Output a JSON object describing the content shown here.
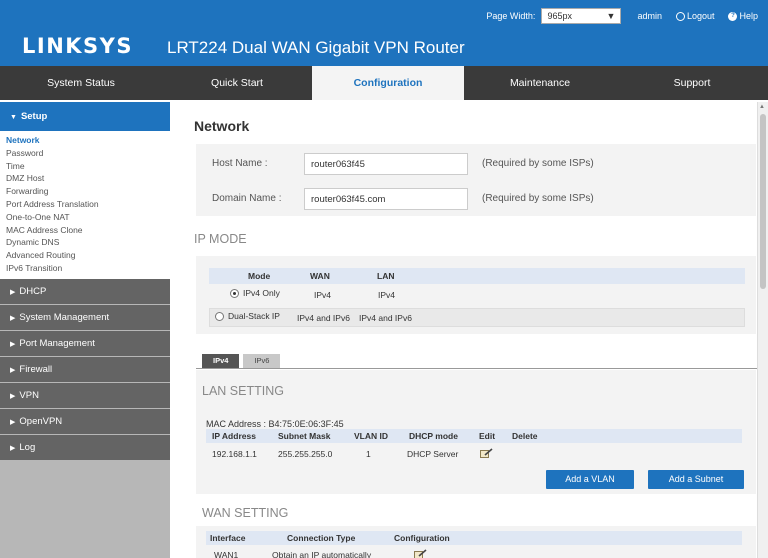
{
  "header": {
    "logo": "LINKSYS",
    "product": "LRT224  Dual WAN Gigabit VPN Router",
    "page_width_label": "Page Width:",
    "page_width_value": "965px",
    "admin": "admin",
    "logout": "Logout",
    "help": "Help"
  },
  "nav": [
    {
      "label": "System Status",
      "active": false
    },
    {
      "label": "Quick Start",
      "active": false
    },
    {
      "label": "Configuration",
      "active": true
    },
    {
      "label": "Maintenance",
      "active": false
    },
    {
      "label": "Support",
      "active": false
    }
  ],
  "sidebar": {
    "setup_label": "Setup",
    "setup_items": [
      "Network",
      "Password",
      "Time",
      "DMZ Host",
      "Forwarding",
      "Port Address Translation",
      "One-to-One NAT",
      "MAC Address Clone",
      "Dynamic DNS",
      "Advanced Routing",
      "IPv6 Transition"
    ],
    "groups": [
      "DHCP",
      "System Management",
      "Port Management",
      "Firewall",
      "VPN",
      "OpenVPN",
      "Log"
    ]
  },
  "main": {
    "title": "Network",
    "host_label": "Host Name :",
    "host_value": "router063f45",
    "host_hint": "(Required by some ISPs)",
    "domain_label": "Domain Name :",
    "domain_value": "router063f45.com",
    "domain_hint": "(Required by some ISPs)",
    "ip_mode_title": "IP MODE",
    "mode_headers": [
      "Mode",
      "WAN",
      "LAN"
    ],
    "mode_rows": [
      {
        "mode": "IPv4 Only",
        "wan": "IPv4",
        "lan": "IPv4",
        "selected": true
      },
      {
        "mode": "Dual-Stack IP",
        "wan": "IPv4 and IPv6",
        "lan": "IPv4 and IPv6",
        "selected": false
      }
    ],
    "proto_tabs": [
      "IPv4",
      "IPv6"
    ],
    "lan_title": "LAN SETTING",
    "mac_label": "MAC Address :",
    "mac_value": "B4:75:0E:06:3F:45",
    "lan_headers": [
      "IP Address",
      "Subnet Mask",
      "VLAN ID",
      "DHCP mode",
      "Edit",
      "Delete"
    ],
    "lan_row": {
      "ip": "192.168.1.1",
      "mask": "255.255.255.0",
      "vlan": "1",
      "dhcp": "DHCP Server"
    },
    "add_vlan": "Add a VLAN",
    "add_subnet": "Add a Subnet",
    "wan_title": "WAN SETTING",
    "wan_headers": [
      "Interface",
      "Connection Type",
      "Configuration"
    ],
    "wan_row": {
      "interface": "WAN1",
      "type": "Obtain an IP automatically"
    }
  }
}
